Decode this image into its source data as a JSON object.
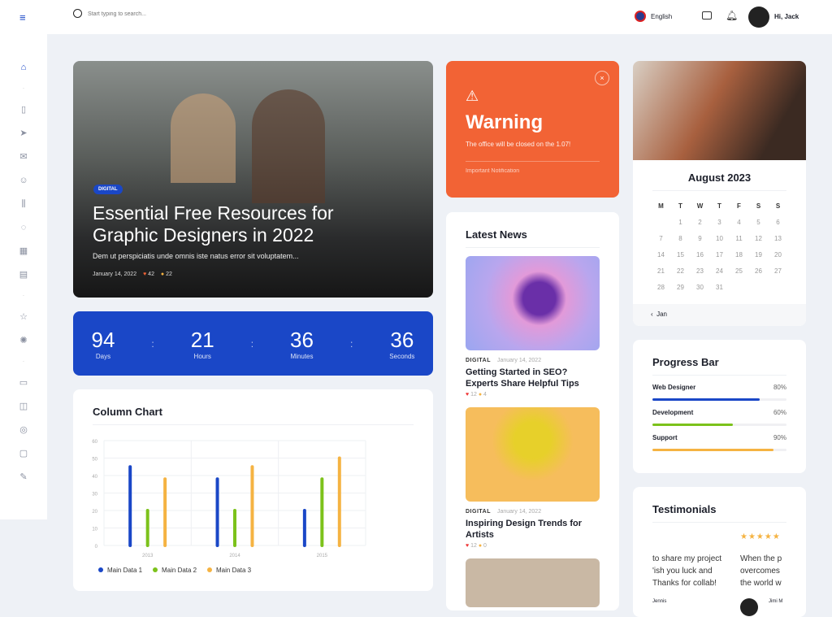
{
  "topbar": {
    "search_placeholder": "Start typing to search...",
    "language": "English",
    "user_greeting": "Hi, Jack"
  },
  "hero": {
    "tag": "DIGITAL",
    "title": "Essential Free Resources for Graphic Designers in 2022",
    "excerpt": "Dem ut perspiciatis unde omnis iste natus error sit voluptatem...",
    "date": "January 14, 2022",
    "likes": "42",
    "comments": "22"
  },
  "countdown": [
    {
      "value": "94",
      "label": "Days"
    },
    {
      "value": "21",
      "label": "Hours"
    },
    {
      "value": "36",
      "label": "Minutes"
    },
    {
      "value": "36",
      "label": "Seconds"
    }
  ],
  "warning": {
    "title": "Warning",
    "message": "The office will be closed on the 1.07!",
    "footer": "Important Notification",
    "color": "#f26335"
  },
  "news": {
    "title": "Latest News",
    "items": [
      {
        "tag": "DIGITAL",
        "date": "January 14, 2022",
        "title": "Getting Started in SEO? Experts Share Helpful Tips",
        "likes": "12",
        "comments": "4"
      },
      {
        "tag": "DIGITAL",
        "date": "January 14, 2022",
        "title": "Inspiring Design Trends for Artists",
        "likes": "12",
        "comments": "0"
      }
    ]
  },
  "calendar": {
    "title": "August 2023",
    "weekdays": [
      "M",
      "T",
      "W",
      "T",
      "F",
      "S",
      "S"
    ],
    "prev": "Jan"
  },
  "progress": {
    "title": "Progress Bar",
    "items": [
      {
        "label": "Web Designer",
        "value": "80%",
        "pct": 80,
        "color": "#1a47c7"
      },
      {
        "label": "Development",
        "value": "60%",
        "pct": 60,
        "color": "#7cc21b"
      },
      {
        "label": "Support",
        "value": "90%",
        "pct": 90,
        "color": "#f5b342"
      }
    ]
  },
  "testimonials": {
    "title": "Testimonials",
    "left_text": "to share my project 'ish you luck and Thanks for collab!",
    "left_name": "Jennis",
    "right_text": "When the p overcomes the world w",
    "right_name": "Jimi M"
  },
  "chart_data": {
    "type": "bar",
    "title": "Column Chart",
    "categories": [
      "2013",
      "2014",
      "2015"
    ],
    "ylim": [
      0,
      60
    ],
    "yticks": [
      0,
      10,
      20,
      30,
      40,
      50,
      60
    ],
    "grid": true,
    "legend": "bottom-left",
    "series": [
      {
        "name": "Main Data 1",
        "color": "#1a47c7",
        "values": [
          45,
          38,
          20
        ]
      },
      {
        "name": "Main Data 2",
        "color": "#7cc21b",
        "values": [
          20,
          20,
          38
        ]
      },
      {
        "name": "Main Data 3",
        "color": "#f5b342",
        "values": [
          38,
          45,
          50
        ]
      }
    ]
  }
}
